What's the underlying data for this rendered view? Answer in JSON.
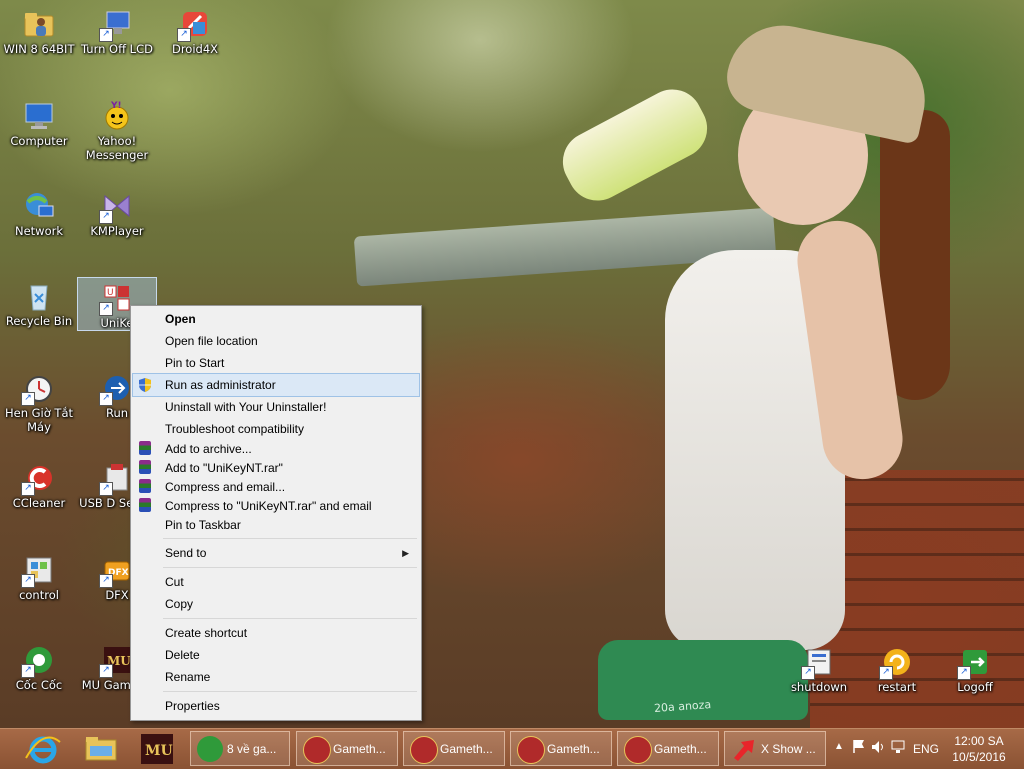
{
  "desktop_icons": [
    {
      "label": "WIN 8 64BIT",
      "icon": "folder-user-icon"
    },
    {
      "label": "Turn Off LCD",
      "icon": "monitor-shortcut-icon"
    },
    {
      "label": "Droid4X",
      "icon": "droid4x-icon"
    },
    {
      "label": "Computer",
      "icon": "computer-icon"
    },
    {
      "label": "Yahoo! Messenger",
      "icon": "yahoo-messenger-icon"
    },
    {
      "label": "Network",
      "icon": "network-icon"
    },
    {
      "label": "KMPlayer",
      "icon": "kmplayer-icon"
    },
    {
      "label": "Recycle Bin",
      "icon": "recycle-bin-icon"
    },
    {
      "label": "UniKe",
      "icon": "unikey-icon"
    },
    {
      "label": "Hen Giờ Tắt Máy",
      "icon": "alarm-clock-icon"
    },
    {
      "label": "Run",
      "icon": "run-icon"
    },
    {
      "label": "CCleaner",
      "icon": "ccleaner-icon"
    },
    {
      "label": "USB D Securi",
      "icon": "usb-security-icon"
    },
    {
      "label": "control",
      "icon": "control-panel-icon"
    },
    {
      "label": "DFX",
      "icon": "dfx-icon"
    },
    {
      "label": "Cốc Cốc",
      "icon": "coccoc-icon"
    },
    {
      "label": "MU GameTh",
      "icon": "mu-game-icon"
    },
    {
      "label": "shutdown",
      "icon": "shutdown-icon"
    },
    {
      "label": "restart",
      "icon": "restart-icon"
    },
    {
      "label": "Logoff",
      "icon": "logoff-icon"
    }
  ],
  "context_menu": {
    "items": [
      {
        "label": "Open"
      },
      {
        "label": "Open file location"
      },
      {
        "label": "Pin to Start"
      },
      {
        "label": "Run as administrator"
      },
      {
        "label": "Uninstall with Your Uninstaller!"
      },
      {
        "label": "Troubleshoot compatibility"
      },
      {
        "label": "Add to archive..."
      },
      {
        "label": "Add to \"UniKeyNT.rar\""
      },
      {
        "label": "Compress and email..."
      },
      {
        "label": "Compress to \"UniKeyNT.rar\" and email"
      },
      {
        "label": "Pin to Taskbar"
      },
      {
        "label": "Send to"
      },
      {
        "label": "Cut"
      },
      {
        "label": "Copy"
      },
      {
        "label": "Create shortcut"
      },
      {
        "label": "Delete"
      },
      {
        "label": "Rename"
      },
      {
        "label": "Properties"
      }
    ]
  },
  "wallpaper_text": "20a anoza",
  "taskbar": {
    "pinned": [
      {
        "icon": "internet-explorer-icon"
      },
      {
        "icon": "file-explorer-icon"
      },
      {
        "icon": "mu-game-icon"
      }
    ],
    "buttons": [
      {
        "label": "8 về ga...",
        "icon": "coccoc-icon"
      },
      {
        "label": "Gameth...",
        "icon": "mu-game-icon"
      },
      {
        "label": "Gameth...",
        "icon": "mu-game-icon"
      },
      {
        "label": "Gameth...",
        "icon": "mu-game-icon"
      },
      {
        "label": "Gameth...",
        "icon": "mu-game-icon"
      },
      {
        "label": "X Show ...",
        "icon": "xshow-icon"
      }
    ],
    "tray": {
      "language": "ENG",
      "time": "12:00 SA",
      "date": "10/5/2016"
    }
  },
  "colors": {
    "menu_bg": "#f0f0f0",
    "menu_highlight": "#dbe8f6",
    "taskbar": "#9a5c3b"
  }
}
